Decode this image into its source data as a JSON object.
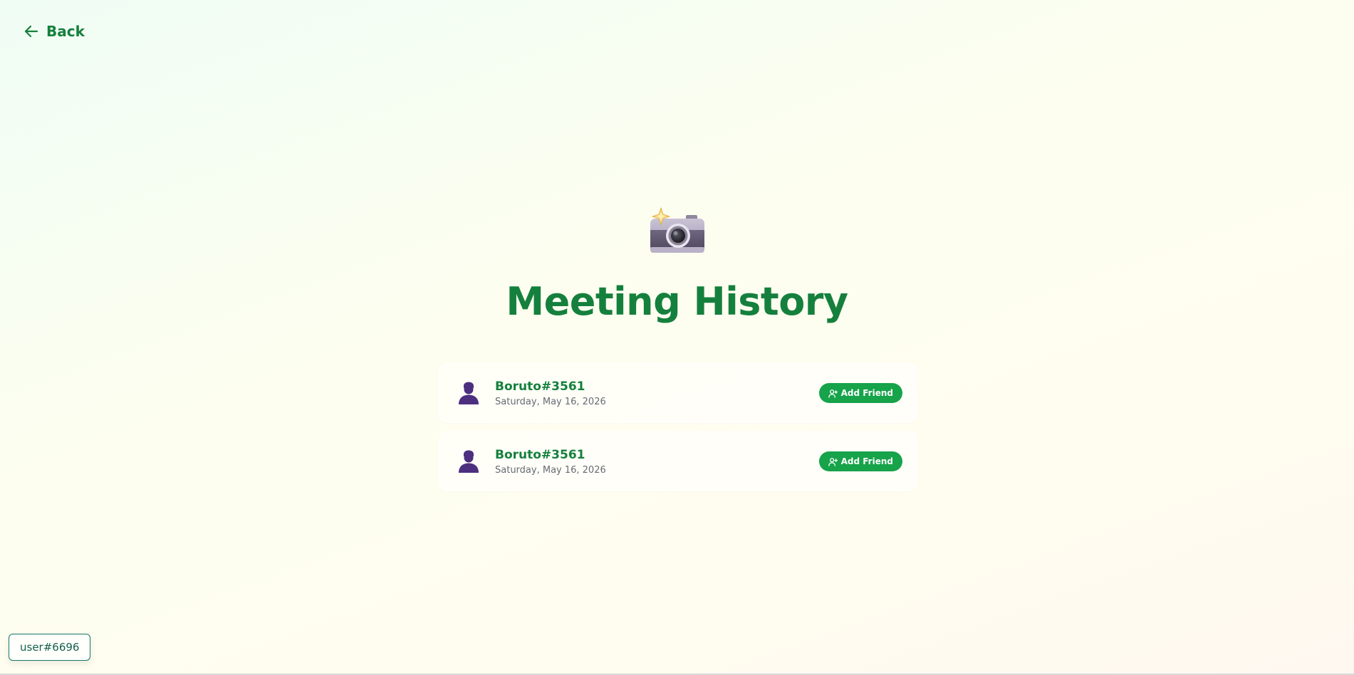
{
  "nav": {
    "back_label": "Back",
    "back_icon": "arrow-left-icon"
  },
  "hero": {
    "icon": "camera-with-flash-icon",
    "title": "Meeting History"
  },
  "history": [
    {
      "name": "Boruto#3561",
      "date": "Saturday, May 16, 2026",
      "avatar_icon": "person-silhouette-icon",
      "action_label": "Add Friend",
      "action_icon": "user-plus-icon"
    },
    {
      "name": "Boruto#3561",
      "date": "Saturday, May 16, 2026",
      "avatar_icon": "person-silhouette-icon",
      "action_label": "Add Friend",
      "action_icon": "user-plus-icon"
    }
  ],
  "user_badge": {
    "label": "user#6696"
  },
  "colors": {
    "primary": "#15803d",
    "button": "#16a34a",
    "avatar": "#4c2f7f",
    "badge_border": "#177a67"
  }
}
